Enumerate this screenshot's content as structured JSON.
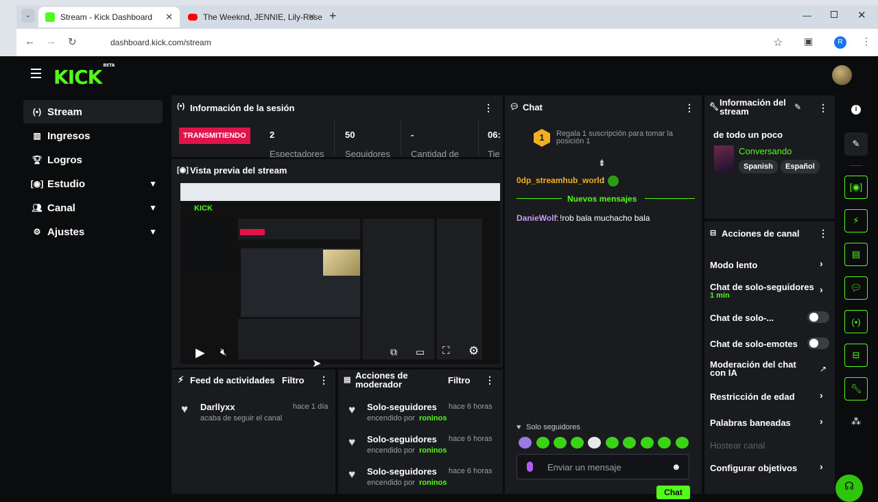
{
  "browser": {
    "tabs": [
      {
        "title": "Stream - Kick Dashboard",
        "active": true
      },
      {
        "title": "The Weeknd, JENNIE, Lily-Rose",
        "active": false
      }
    ],
    "new_tab": "+",
    "url": "dashboard.kick.com/stream",
    "profile_initial": "R"
  },
  "app": {
    "brand": "KICK",
    "brand_badge": "BETA",
    "accent": "#53fc18"
  },
  "sidebar": {
    "items": [
      {
        "label": "Stream",
        "icon": "broadcast-icon"
      },
      {
        "label": "Ingresos",
        "icon": "chart-icon"
      },
      {
        "label": "Logros",
        "icon": "trophy-icon"
      },
      {
        "label": "Estudio",
        "icon": "studio-icon"
      },
      {
        "label": "Canal",
        "icon": "users-icon"
      },
      {
        "label": "Ajustes",
        "icon": "gear-icon"
      }
    ]
  },
  "session": {
    "title": "Información de la sesión",
    "status": "TRANSMITIENDO",
    "stats": [
      {
        "value": "2",
        "label": "Espectadores"
      },
      {
        "value": "50",
        "label": "Seguidores"
      },
      {
        "value": "-",
        "label": "Cantidad de"
      },
      {
        "value": "06:",
        "label": "Tie"
      }
    ]
  },
  "preview": {
    "title": "Vista previa del stream"
  },
  "activity": {
    "title": "Feed de actividades",
    "filter": "Filtro",
    "items": [
      {
        "name": "Darllyxx",
        "time": "hace 1 día",
        "detail": "acaba de seguir el canal"
      }
    ]
  },
  "mod_actions": {
    "title": "Acciones de moderador",
    "filter": "Filtro",
    "items": [
      {
        "name": "Solo-seguidores",
        "time": "hace 6 horas",
        "detail": "encendido por",
        "user": "roninos"
      },
      {
        "name": "Solo-seguidores",
        "time": "hace 6 horas",
        "detail": "encendido por",
        "user": "roninos"
      },
      {
        "name": "Solo-seguidores",
        "time": "hace 6 horas",
        "detail": "encendido por",
        "user": "roninos"
      }
    ]
  },
  "chat": {
    "title": "Chat",
    "gift_badge": "1",
    "gift_text": "Regala 1 suscripción para tomar la posición 1",
    "messages": [
      {
        "user": "0dp_streamhub_world",
        "sep": ":",
        "text": ""
      },
      {
        "user": "DanieWolf",
        "sep": ":",
        "text": "!rob bala muchacho bala"
      }
    ],
    "new_messages": "Nuevos mensajes",
    "mode_label": "Solo seguidores",
    "input_placeholder": "Enviar un mensaje",
    "send": "Chat"
  },
  "stream_info": {
    "title": "Información del stream",
    "stream_title": "de todo un poco",
    "category": "Conversando",
    "tags": [
      "Spanish",
      "Español"
    ]
  },
  "channel_actions": {
    "title": "Acciones de canal",
    "items": [
      {
        "label": "Modo lento",
        "sub": "",
        "control": "chevron"
      },
      {
        "label": "Chat de solo-seguidores",
        "sub": "1 min",
        "control": "chevron"
      },
      {
        "label": "Chat de solo-...",
        "sub": "",
        "control": "toggle"
      },
      {
        "label": "Chat de solo-emotes",
        "sub": "",
        "control": "toggle"
      },
      {
        "label": "Moderación del chat con IA",
        "sub": "",
        "control": "external"
      },
      {
        "label": "Restricción de edad",
        "sub": "",
        "control": "chevron"
      },
      {
        "label": "Palabras baneadas",
        "sub": "",
        "control": "chevron"
      },
      {
        "label": "Hostear canal",
        "sub": "",
        "control": "disabled"
      },
      {
        "label": "Configurar objetivos",
        "sub": "",
        "control": "chevron"
      }
    ]
  }
}
